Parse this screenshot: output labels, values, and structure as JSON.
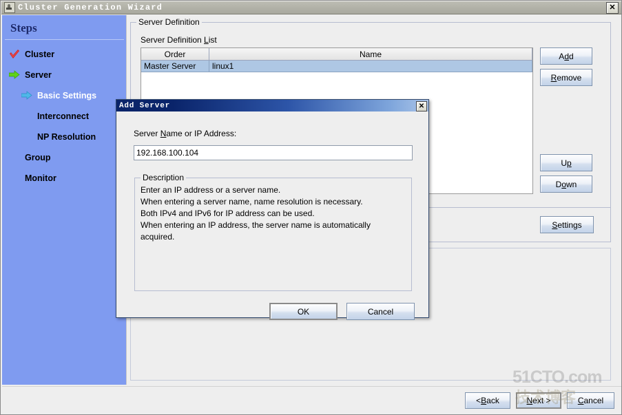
{
  "window": {
    "title": "Cluster Generation Wizard",
    "icon": "java-duke-icon",
    "close_label": "✕"
  },
  "sidebar": {
    "heading": "Steps",
    "items": [
      {
        "label": "Cluster",
        "icon": "check-icon",
        "level": 0,
        "state": "done"
      },
      {
        "label": "Server",
        "icon": "arrow-right-icon",
        "level": 0,
        "state": "active"
      },
      {
        "label": "Basic Settings",
        "icon": "arrow-right-icon",
        "level": 1,
        "state": "current"
      },
      {
        "label": "Interconnect",
        "icon": "none",
        "level": 1,
        "state": "pending"
      },
      {
        "label": "NP Resolution",
        "icon": "none",
        "level": 1,
        "state": "pending"
      },
      {
        "label": "Group",
        "icon": "none",
        "level": 0,
        "state": "pending"
      },
      {
        "label": "Monitor",
        "icon": "none",
        "level": 0,
        "state": "pending"
      }
    ],
    "colors": {
      "background": "#7f9bf0",
      "heading_text": "#1d2a6b",
      "current_text": "#ffffff",
      "check_icon": "#d42020",
      "active_arrow": "#5fd317",
      "current_arrow": "#4fb8e8"
    }
  },
  "main": {
    "group_title": "Server Definition",
    "list_label_pre": "Server Definition ",
    "list_label_mnemonic": "L",
    "list_label_post": "ist",
    "table": {
      "columns": [
        "Order",
        "Name"
      ],
      "rows": [
        {
          "order": "Master Server",
          "name": "linux1"
        }
      ],
      "selected_row": 0,
      "selection_color": "#aec7e4"
    },
    "buttons": {
      "add": {
        "pre": "A",
        "mn": "d",
        "post": "d"
      },
      "remove": {
        "pre": "",
        "mn": "R",
        "post": "emove"
      },
      "up": {
        "pre": "U",
        "mn": "p",
        "post": ""
      },
      "down": {
        "pre": "D",
        "mn": "o",
        "post": "wn"
      },
      "settings": {
        "pre": "",
        "mn": "S",
        "post": "ettings"
      }
    }
  },
  "footer": {
    "back": {
      "pre": "< ",
      "mn": "B",
      "post": "ack"
    },
    "next": {
      "pre": "",
      "mn": "N",
      "post": "ext >"
    },
    "cancel": {
      "pre": "",
      "mn": "C",
      "post": "ancel"
    }
  },
  "watermark": {
    "line1": "51CTO.com",
    "line2": "技术博客"
  },
  "dialog": {
    "title": "Add Server",
    "close_label": "✕",
    "field_label_pre": "Server ",
    "field_label_mnemonic": "N",
    "field_label_post": "ame or IP Address:",
    "input_value": "192.168.100.104",
    "input_placeholder": "",
    "description_title": "Description",
    "description_text": "Enter an IP address or a server name.\nWhen entering a server name, name resolution is necessary.\nBoth IPv4 and IPv6 for IP address can be used.\nWhen entering an IP address, the server name is automatically\nacquired.",
    "ok_label": "OK",
    "cancel_label": "Cancel"
  }
}
